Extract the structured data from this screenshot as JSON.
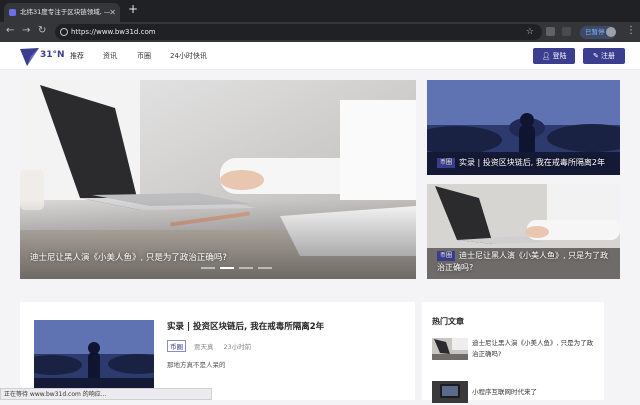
{
  "browser": {
    "tab_title": "北纬31度专注于区块链领域, —",
    "url": "https://www.bw31d.com",
    "paused_label": "已暂停",
    "status_text": "正在等待 www.bw31d.com 的响应..."
  },
  "site": {
    "logo_text": "31°N",
    "nav": [
      "推荐",
      "资讯",
      "币圈",
      "24小时快讯"
    ],
    "login": "登陆",
    "register": "注册"
  },
  "hero": {
    "caption": "迪士尼让黑人演《小美人鱼》, 只是为了政治正确吗?",
    "carousel_pages": 4,
    "carousel_active": 2
  },
  "side_top": {
    "tag": "币圈",
    "caption": "实录 | 投资区块链后, 我在戒毒所隔离2年"
  },
  "side_bottom": {
    "tag": "币圈",
    "caption": "迪士尼让黑人演《小美人鱼》, 只是为了政治正确吗?"
  },
  "article": {
    "title": "实录 | 投资区块链后, 我在戒毒所隔离2年",
    "tag": "币圈",
    "author": "贾天真",
    "time": "23小时前",
    "excerpt": "那地方真不是人呆的"
  },
  "hot": {
    "heading": "热门文章",
    "items": [
      "迪士尼让黑人演《小美人鱼》, 只是为了政治正确吗?",
      "小程序互联网时代来了"
    ]
  },
  "colors": {
    "brand": "#3b3d8e",
    "chrome_dark": "#202124"
  }
}
